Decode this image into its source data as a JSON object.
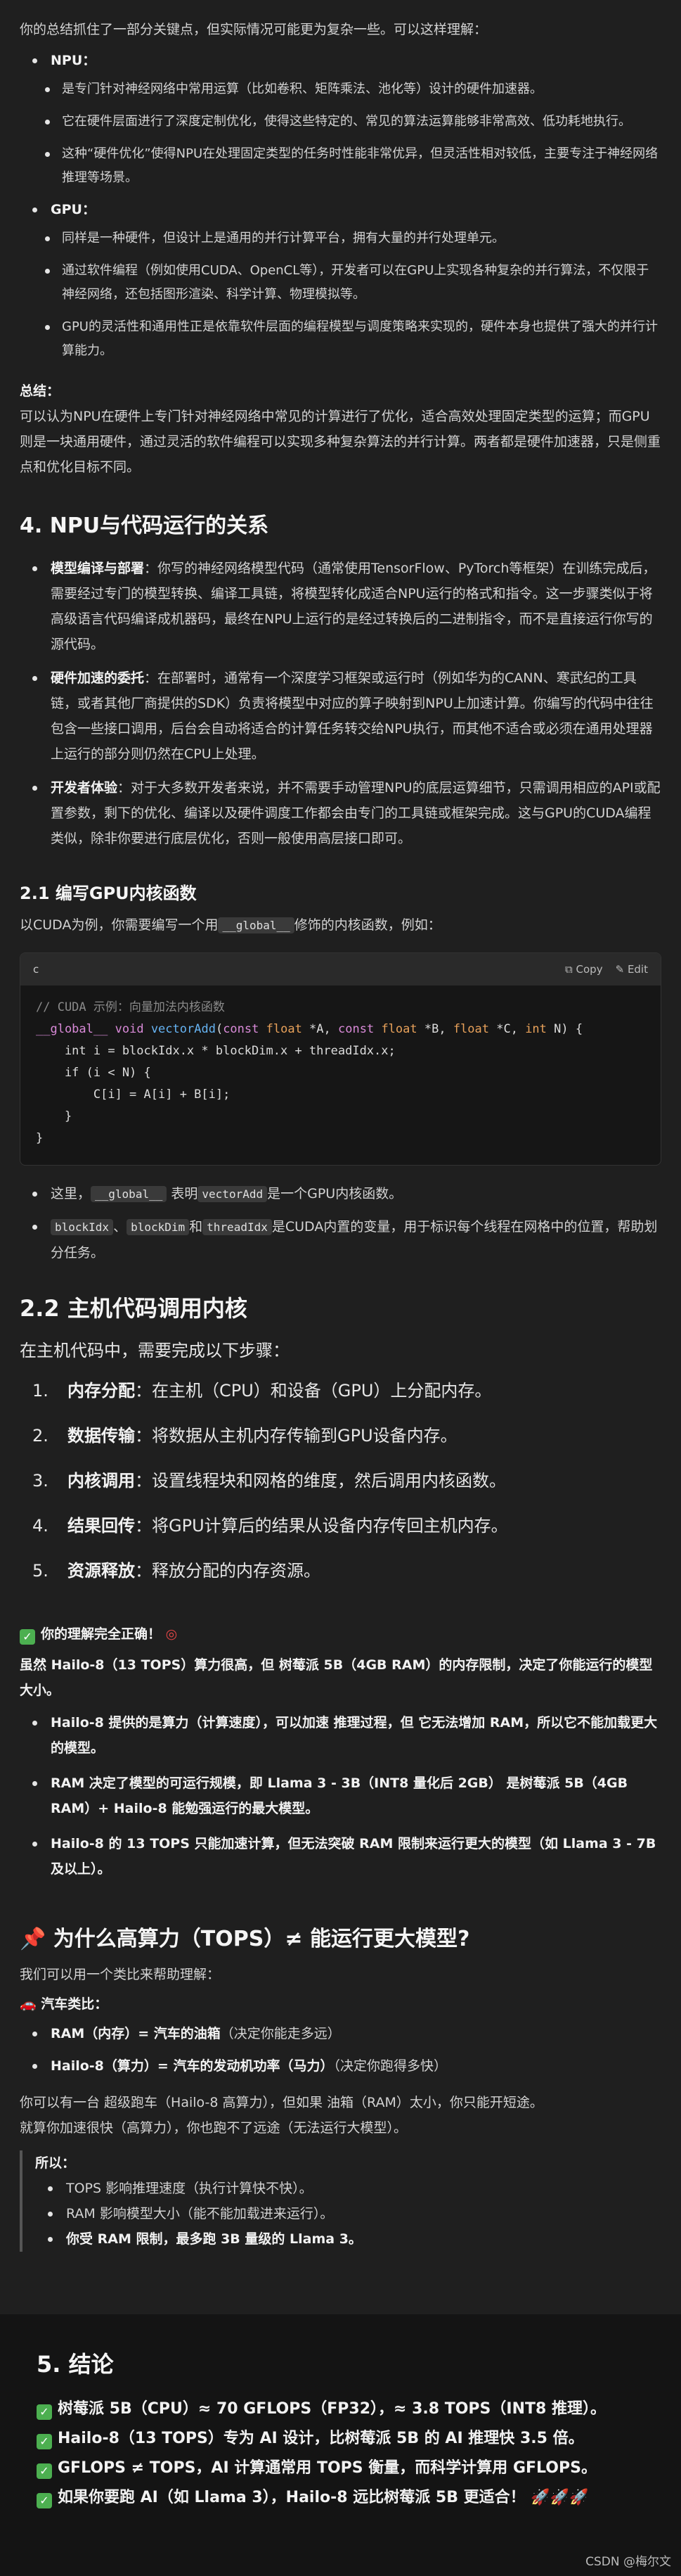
{
  "intro": "你的总结抓住了一部分关键点，但实际情况可能更为复杂一些。可以这样理解：",
  "npu": {
    "title": "NPU：",
    "items": [
      "是专门针对神经网络中常用运算（比如卷积、矩阵乘法、池化等）设计的硬件加速器。",
      "它在硬件层面进行了深度定制优化，使得这些特定的、常见的算法运算能够非常高效、低功耗地执行。",
      "这种“硬件优化”使得NPU在处理固定类型的任务时性能非常优异，但灵活性相对较低，主要专注于神经网络推理等场景。"
    ]
  },
  "gpu": {
    "title": "GPU：",
    "items": [
      "同样是一种硬件，但设计上是通用的并行计算平台，拥有大量的并行处理单元。",
      "通过软件编程（例如使用CUDA、OpenCL等），开发者可以在GPU上实现各种复杂的并行算法，不仅限于神经网络，还包括图形渲染、科学计算、物理模拟等。",
      "GPU的灵活性和通用性正是依靠软件层面的编程模型与调度策略来实现的，硬件本身也提供了强大的并行计算能力。"
    ]
  },
  "summary": {
    "title": "总结：",
    "text": "可以认为NPU在硬件上专门针对神经网络中常见的计算进行了优化，适合高效处理固定类型的运算；而GPU则是一块通用硬件，通过灵活的软件编程可以实现多种复杂算法的并行计算。两者都是硬件加速器，只是侧重点和优化目标不同。"
  },
  "section4": {
    "heading": "4. NPU与代码运行的关系",
    "items": [
      {
        "bold": "模型编译与部署",
        "text": "：你写的神经网络模型代码（通常使用TensorFlow、PyTorch等框架）在训练完成后，需要经过专门的模型转换、编译工具链，将模型转化成适合NPU运行的格式和指令。这一步骤类似于将高级语言代码编译成机器码，最终在NPU上运行的是经过转换后的二进制指令，而不是直接运行你写的源代码。"
      },
      {
        "bold": "硬件加速的委托",
        "text": "：在部署时，通常有一个深度学习框架或运行时（例如华为的CANN、寒武纪的工具链，或者其他厂商提供的SDK）负责将模型中对应的算子映射到NPU上加速计算。你编写的代码中往往包含一些接口调用，后台会自动将适合的计算任务转交给NPU执行，而其他不适合或必须在通用处理器上运行的部分则仍然在CPU上处理。"
      },
      {
        "bold": "开发者体验",
        "text": "：对于大多数开发者来说，并不需要手动管理NPU的底层运算细节，只需调用相应的API或配置参数，剩下的优化、编译以及硬件调度工作都会由专门的工具链或框架完成。这与GPU的CUDA编程类似，除非你要进行底层优化，否则一般使用高层接口即可。"
      }
    ]
  },
  "section21": {
    "heading": "2.1 编写GPU内核函数",
    "intro_a": "以CUDA为例，你需要编写一个用",
    "intro_code": "__global__",
    "intro_b": "修饰的内核函数，例如：",
    "code": {
      "lang": "c",
      "copy": "Copy",
      "edit": "Edit",
      "comment": "// CUDA 示例：向量加法内核函数",
      "lines": [
        "    int i = blockIdx.x * blockDim.x + threadIdx.x;",
        "    if (i < N) {",
        "        C[i] = A[i] + B[i];",
        "    }",
        "}"
      ]
    },
    "note1_a": "这里，",
    "note1_code1": "__global__",
    "note1_b": "表明",
    "note1_code2": "vectorAdd",
    "note1_c": "是一个GPU内核函数。",
    "note2_code1": "blockIdx",
    "note2_sep1": "、",
    "note2_code2": "blockDim",
    "note2_and": "和",
    "note2_code3": "threadIdx",
    "note2_text": "是CUDA内置的变量，用于标识每个线程在网格中的位置，帮助划分任务。"
  },
  "section22": {
    "heading": "2.2 主机代码调用内核",
    "intro": "在主机代码中，需要完成以下步骤：",
    "steps": [
      {
        "n": "1.",
        "bold": "内存分配",
        "text": "：在主机（CPU）和设备（GPU）上分配内存。"
      },
      {
        "n": "2.",
        "bold": "数据传输",
        "text": "：将数据从主机内存传输到GPU设备内存。"
      },
      {
        "n": "3.",
        "bold": "内核调用",
        "text": "：设置线程块和网格的维度，然后调用内核函数。"
      },
      {
        "n": "4.",
        "bold": "结果回传",
        "text": "：将GPU计算后的结果从设备内存传回主机内存。"
      },
      {
        "n": "5.",
        "bold": "资源释放",
        "text": "：释放分配的内存资源。"
      }
    ]
  },
  "correct": {
    "title": "你的理解完全正确！",
    "para": "虽然 Hailo-8（13 TOPS）算力很高，但 树莓派 5B（4GB RAM）的内存限制，决定了你能运行的模型大小。",
    "items": [
      "Hailo-8 提供的是算力（计算速度），可以加速 推理过程，但 它无法增加 RAM，所以它不能加载更大的模型。",
      "RAM 决定了模型的可运行规模，即 Llama 3 - 3B（INT8 量化后 2GB） 是树莓派 5B（4GB RAM）+ Hailo-8 能勉强运行的最大模型。",
      "Hailo-8 的 13 TOPS 只能加速计算，但无法突破 RAM 限制来运行更大的模型（如 Llama 3 - 7B 及以上）。"
    ]
  },
  "why": {
    "heading": "为什么高算力（TOPS）≠ 能运行更大模型?",
    "intro": "我们可以用一个类比来帮助理解：",
    "car_title": "汽车类比：",
    "car_items": [
      {
        "bold": "RAM（内存）= 汽车的油箱",
        "text": "（决定你能走多远）"
      },
      {
        "bold": "Hailo-8（算力）= 汽车的发动机功率（马力）",
        "text": "（决定你跑得多快）"
      }
    ],
    "para1": "你可以有一台 超级跑车（Hailo-8 高算力），但如果 油箱（RAM）太小，你只能开短途。",
    "para2": "就算你加速很快（高算力），你也跑不了远途（无法运行大模型）。",
    "so_title": "所以：",
    "so_items": [
      "TOPS 影响推理速度（执行计算快不快）。",
      "RAM 影响模型大小（能不能加载进来运行）。",
      "你受 RAM 限制，最多跑 3B 量级的 Llama 3。"
    ]
  },
  "conclusion": {
    "heading": "5. 结论",
    "items": [
      "树莓派 5B（CPU）≈ 70 GFLOPS（FP32），≈ 3.8 TOPS（INT8 推理）。",
      "Hailo-8（13 TOPS）专为 AI 设计，比树莓派 5B 的 AI 推理快 3.5 倍。",
      "GFLOPS ≠ TOPS，AI 计算通常用 TOPS 衡量，而科学计算用 GFLOPS。",
      "如果你要跑 AI（如 Llama 3），Hailo-8 远比树莓派 5B 更适合！"
    ],
    "rockets": "🚀🚀🚀"
  },
  "watermark": "CSDN @梅尔文"
}
